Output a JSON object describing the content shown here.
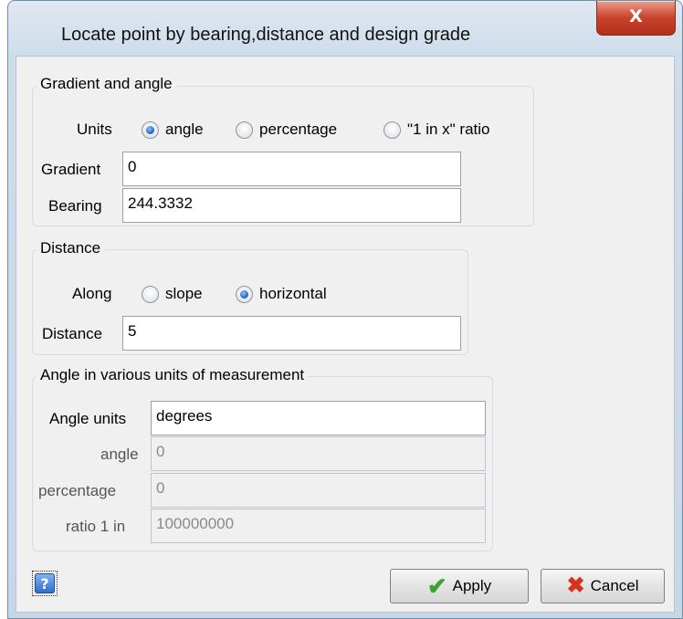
{
  "window": {
    "title": "Locate point by bearing,distance and design grade",
    "close_glyph": "X"
  },
  "gradient_group": {
    "legend": "Gradient and angle",
    "units_label": "Units",
    "units_options": [
      "angle",
      "percentage",
      "\"1 in x\" ratio"
    ],
    "units_selected": "angle",
    "gradient_label": "Gradient",
    "gradient_value": "0",
    "bearing_label": "Bearing",
    "bearing_value": "244.3332"
  },
  "distance_group": {
    "legend": "Distance",
    "along_label": "Along",
    "along_options": [
      "slope",
      "horizontal"
    ],
    "along_selected": "horizontal",
    "distance_label": "Distance",
    "distance_value": "5"
  },
  "angle_group": {
    "legend": "Angle in various units of measurement",
    "angle_units_label": "Angle units",
    "angle_units_value": "degrees",
    "angle_label": "angle",
    "angle_value": "0",
    "percentage_label": "percentage",
    "percentage_value": "0",
    "ratio_label": "ratio 1 in",
    "ratio_value": "100000000"
  },
  "buttons": {
    "help_glyph": "?",
    "apply_label": "Apply",
    "cancel_label": "Cancel"
  },
  "icons": {
    "apply": "checkmark-icon",
    "cancel": "red-x-icon",
    "help": "question-icon"
  },
  "colors": {
    "check": "#3aa42f",
    "cancel_x": "#d8321e",
    "radio_dot": "#1a5fb8"
  }
}
